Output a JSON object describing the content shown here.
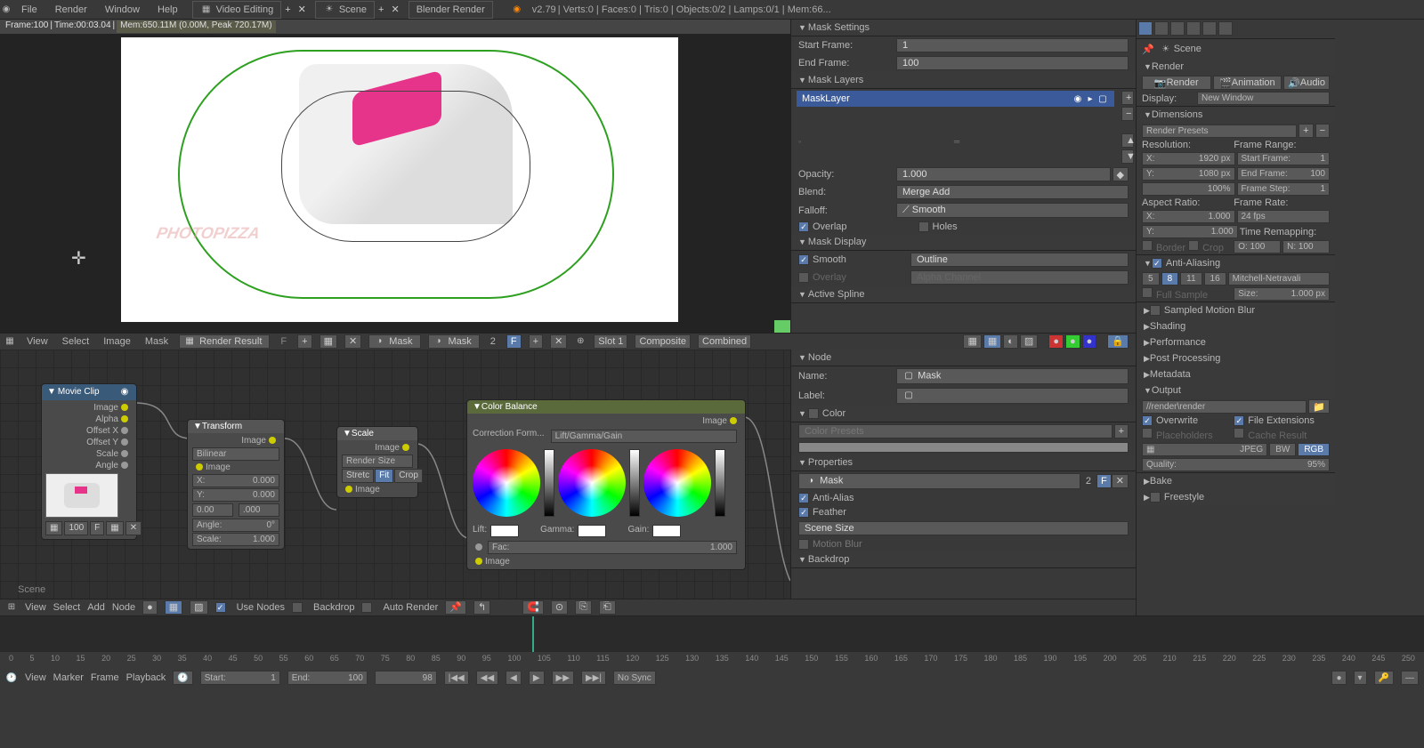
{
  "topbar": {
    "menus": [
      "File",
      "Render",
      "Window",
      "Help"
    ],
    "layout_label": "Video Editing",
    "scene_label": "Scene",
    "engine": "Blender Render",
    "version": "v2.79",
    "stats": "Verts:0 | Faces:0 | Tris:0 | Objects:0/2 | Lamps:0/1 | Mem:66...",
    "plus": "+",
    "x": "✕"
  },
  "frame_bar": {
    "frame": "Frame:100",
    "time": "Time:00:03.04",
    "mem": "Mem:650.11M (0.00M, Peak 720.17M)"
  },
  "mask_panel": {
    "settings_hdr": "Mask Settings",
    "start_frame_lbl": "Start Frame:",
    "start_frame_val": "1",
    "end_frame_lbl": "End Frame:",
    "end_frame_val": "100",
    "layers_hdr": "Mask Layers",
    "layer_name": "MaskLayer",
    "opacity_lbl": "Opacity:",
    "opacity_val": "1.000",
    "blend_lbl": "Blend:",
    "blend_val": "Merge Add",
    "falloff_lbl": "Falloff:",
    "falloff_val": "Smooth",
    "overlap_lbl": "Overlap",
    "holes_lbl": "Holes",
    "display_hdr": "Mask Display",
    "smooth_lbl": "Smooth",
    "smooth_mode": "Outline",
    "overlay_lbl": "Overlay",
    "overlay_mode": "Alpha Channel",
    "active_spline_hdr": "Active Spline"
  },
  "img_editor": {
    "menus": [
      "View",
      "Select",
      "Image",
      "Mask"
    ],
    "result": "Render Result",
    "f": "F",
    "mask1": "Mask",
    "mask2": "Mask",
    "two": "2",
    "slot": "Slot 1",
    "composite": "Composite",
    "combined": "Combined"
  },
  "nodes": {
    "movieclip": {
      "title": "Movie Clip",
      "outs": [
        "Image",
        "Alpha",
        "Offset X",
        "Offset Y",
        "Scale",
        "Angle"
      ],
      "footer_num": "100",
      "footer_f": "F"
    },
    "transform": {
      "title": "Transform",
      "out": "Image",
      "interp": "Bilinear",
      "in": "Image",
      "x_lbl": "X:",
      "x_val": "0.000",
      "y_lbl": "Y:",
      "y_val": "0.000",
      "angle_lbl": "Angle:",
      "angle_val": "0°",
      "scale_lbl": "Scale:",
      "scale_val": "1.000",
      "zeros": "0.00"
    },
    "scale": {
      "title": "Scale",
      "out": "Image",
      "mode": "Render Size",
      "stretch": "Stretc",
      "fit": "Fit",
      "crop": "Crop",
      "in": "Image"
    },
    "colorbal": {
      "title": "Color Balance",
      "out": "Image",
      "form_lbl": "Correction Form...",
      "form_val": "Lift/Gamma/Gain",
      "lift": "Lift:",
      "gamma": "Gamma:",
      "gain": "Gain:",
      "fac_lbl": "Fac:",
      "fac_val": "1.000",
      "in": "Image"
    }
  },
  "nodeprops": {
    "node_hdr": "Node",
    "name_lbl": "Name:",
    "name_val": "Mask",
    "label_lbl": "Label:",
    "color_hdr": "Color",
    "presets_lbl": "Color Presets",
    "props_hdr": "Properties",
    "mask_sel": "Mask",
    "two": "2",
    "f": "F",
    "antialias": "Anti-Alias",
    "feather": "Feather",
    "scenesize": "Scene Size",
    "motionblur": "Motion Blur",
    "backdrop_hdr": "Backdrop"
  },
  "scene_label": "Scene",
  "bottom_tb": {
    "menus": [
      "View",
      "Select",
      "Add",
      "Node"
    ],
    "use_nodes": "Use Nodes",
    "backdrop": "Backdrop",
    "auto_render": "Auto Render"
  },
  "tl_ticks": [
    "0",
    "5",
    "10",
    "15",
    "20",
    "25",
    "30",
    "35",
    "40",
    "45",
    "50",
    "55",
    "60",
    "65",
    "70",
    "75",
    "80",
    "85",
    "90",
    "95",
    "100",
    "105",
    "110",
    "115",
    "120",
    "125",
    "130",
    "135",
    "140",
    "145",
    "150",
    "155",
    "160",
    "165",
    "170",
    "175",
    "180",
    "185",
    "190",
    "195",
    "200",
    "205",
    "210",
    "215",
    "220",
    "225",
    "230",
    "235",
    "240",
    "245",
    "250"
  ],
  "tl_controls": {
    "menus": [
      "View",
      "Marker",
      "Frame",
      "Playback"
    ],
    "start_lbl": "Start:",
    "start_val": "1",
    "end_lbl": "End:",
    "end_val": "100",
    "cur_val": "98",
    "nosync": "No Sync",
    "rew": "|◀◀",
    "prev": "◀◀",
    "play_rev": "◀",
    "play": "▶",
    "next": "▶▶",
    "ffwd": "▶▶|"
  },
  "right_sidebar": {
    "scene_hdr": "Scene",
    "render_hdr": "Render",
    "render_btn": "Render",
    "anim_btn": "Animation",
    "audio_btn": "Audio",
    "display_lbl": "Display:",
    "display_val": "New Window",
    "dim_hdr": "Dimensions",
    "presets": "Render Presets",
    "res_lbl": "Resolution:",
    "range_lbl": "Frame Range:",
    "x_lbl": "X:",
    "x_val": "1920 px",
    "y_lbl": "Y:",
    "y_val": "1080 px",
    "pct": "100%",
    "sf_lbl": "Start Frame:",
    "sf_val": "1",
    "ef_lbl": "End Frame:",
    "ef_val": "100",
    "fs_lbl": "Frame Step:",
    "fs_val": "1",
    "ar_lbl": "Aspect Ratio:",
    "fr_lbl": "Frame Rate:",
    "ax_lbl": "X:",
    "ax_val": "1.000",
    "fps": "24 fps",
    "ay_lbl": "Y:",
    "ay_val": "1.000",
    "remap_lbl": "Time Remapping:",
    "border": "Border",
    "crop": "Crop",
    "o_lbl": "O: 100",
    "n_lbl": "N: 100",
    "aa_hdr": "Anti-Aliasing",
    "aa5": "5",
    "aa8": "8",
    "aa11": "11",
    "aa16": "16",
    "aa_filter": "Mitchell-Netravali",
    "fullsample": "Full Sample",
    "size_lbl": "Size:",
    "size_val": "1.000 px",
    "smb_hdr": "Sampled Motion Blur",
    "shading_hdr": "Shading",
    "perf_hdr": "Performance",
    "post_hdr": "Post Processing",
    "meta_hdr": "Metadata",
    "output_hdr": "Output",
    "output_path": "//render\\render",
    "overwrite": "Overwrite",
    "fileext": "File Extensions",
    "placeholders": "Placeholders",
    "cache": "Cache Result",
    "jpeg": "JPEG",
    "bw": "BW",
    "rgb": "RGB",
    "quality_lbl": "Quality:",
    "quality_val": "95%",
    "bake_hdr": "Bake",
    "freestyle_hdr": "Freestyle"
  }
}
